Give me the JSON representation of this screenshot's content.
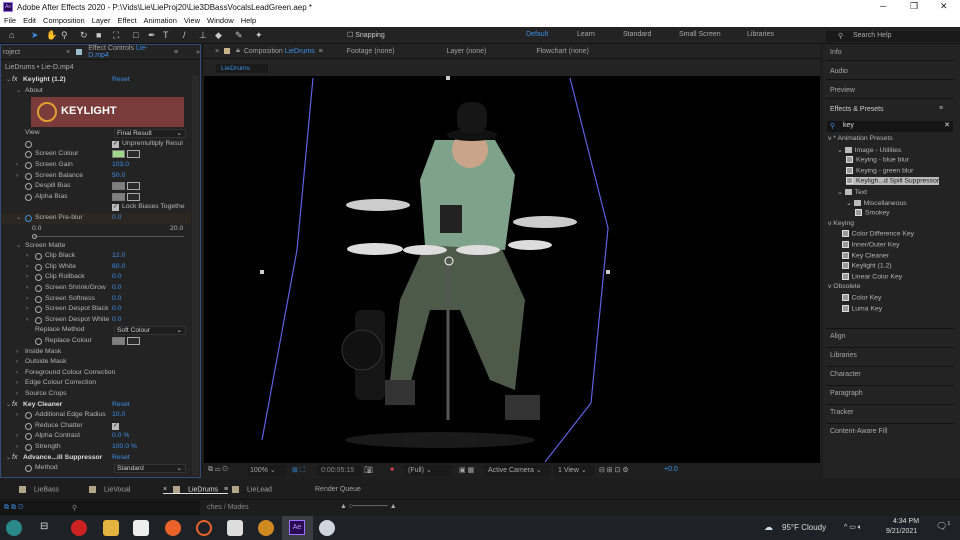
{
  "window": {
    "title": "Adobe After Effects 2020 - P:\\Vids\\Lie\\LieProj20\\Lie3DBassVocalsLeadGreen.aep *",
    "app_icon": "Ae"
  },
  "menu": [
    "File",
    "Edit",
    "Composition",
    "Layer",
    "Effect",
    "Animation",
    "View",
    "Window",
    "Help"
  ],
  "toolbar": {
    "snapping": "Snapping",
    "workspaces": [
      "Default",
      "Learn",
      "Standard",
      "Small Screen",
      "Libraries"
    ],
    "search_help": "Search Help"
  },
  "left_panel": {
    "tab_project": "roject",
    "tab_effect_controls": "Effect Controls",
    "tab_layer": "Lie-D.mp4",
    "subtitle": "LieDrums • Lie-D.mp4",
    "banner_text": "KEYLIGHT",
    "rows": [
      {
        "label": "Keylight (1.2)",
        "fx": true,
        "tw": "v",
        "val": "Reset",
        "type": "reset"
      },
      {
        "label": "About",
        "ind": 1,
        "tw": "v"
      },
      {
        "type": "banner"
      },
      {
        "label": "View",
        "ind": 1,
        "val": "Final Result",
        "type": "dd"
      },
      {
        "sw": true,
        "ind": 1,
        "val": "Unpremultiply Resul",
        "type": "check"
      },
      {
        "label": "Screen Colour",
        "ind": 1,
        "sw": true,
        "type": "swatch",
        "color": "#9fd88a"
      },
      {
        "label": "Screen Gain",
        "ind": 1,
        "sw": true,
        "tw": ">",
        "val": "103.0",
        "type": "num"
      },
      {
        "label": "Screen Balance",
        "ind": 1,
        "sw": true,
        "tw": ">",
        "val": "50.0",
        "type": "num"
      },
      {
        "label": "Despill Bias",
        "ind": 1,
        "sw": true,
        "type": "swatch",
        "color": "#808080"
      },
      {
        "label": "Alpha Bias",
        "ind": 1,
        "sw": true,
        "type": "swatch",
        "color": "#808080"
      },
      {
        "ind": 1,
        "val": "Lock Biases Togethe",
        "type": "check"
      },
      {
        "label": "Screen Pre-blur",
        "ind": 1,
        "sw": true,
        "tw": "v",
        "val": "0.0",
        "type": "num",
        "hl": true,
        "swblue": true
      },
      {
        "type": "slider",
        "min": "0.0",
        "max": "20.0",
        "value": 0
      },
      {
        "label": "Screen Matte",
        "ind": 1,
        "tw": "v"
      },
      {
        "label": "Clip Black",
        "ind": 2,
        "sw": true,
        "tw": ">",
        "val": "12.0",
        "type": "num"
      },
      {
        "label": "Clip White",
        "ind": 2,
        "sw": true,
        "tw": ">",
        "val": "60.0",
        "type": "num"
      },
      {
        "label": "Clip Rollback",
        "ind": 2,
        "sw": true,
        "tw": ">",
        "val": "0.0",
        "type": "num"
      },
      {
        "label": "Screen Shrink/Grow",
        "ind": 2,
        "sw": true,
        "tw": ">",
        "val": "0.0",
        "type": "num"
      },
      {
        "label": "Screen Softness",
        "ind": 2,
        "sw": true,
        "tw": ">",
        "val": "0.0",
        "type": "num"
      },
      {
        "label": "Screen Despot Black",
        "ind": 2,
        "sw": true,
        "tw": ">",
        "val": "0.0",
        "type": "num"
      },
      {
        "label": "Screen Despot White",
        "ind": 2,
        "sw": true,
        "tw": ">",
        "val": "0.0",
        "type": "num"
      },
      {
        "label": "Replace Method",
        "ind": 2,
        "val": "Soft Colour",
        "type": "dd"
      },
      {
        "label": "Replace Colour",
        "ind": 2,
        "sw": true,
        "type": "swatch",
        "color": "#808080"
      },
      {
        "label": "Inside Mask",
        "ind": 1,
        "tw": ">"
      },
      {
        "label": "Outside Mask",
        "ind": 1,
        "tw": ">"
      },
      {
        "label": "Foreground Colour Correction",
        "ind": 1,
        "tw": ">"
      },
      {
        "label": "Edge Colour Correction",
        "ind": 1,
        "tw": ">"
      },
      {
        "label": "Source Crops",
        "ind": 1,
        "tw": ">"
      },
      {
        "label": "Key Cleaner",
        "fx": true,
        "tw": "v",
        "val": "Reset",
        "type": "reset"
      },
      {
        "label": "Additional Edge Radius",
        "ind": 1,
        "sw": true,
        "tw": ">",
        "val": "10.0",
        "type": "num"
      },
      {
        "label": "Reduce Chatter",
        "ind": 1,
        "sw": true,
        "type": "check",
        "val": ""
      },
      {
        "label": "Alpha Contrast",
        "ind": 1,
        "sw": true,
        "tw": ">",
        "val": "0.0 %",
        "type": "num"
      },
      {
        "label": "Strength",
        "ind": 1,
        "sw": true,
        "tw": ">",
        "val": "100.0 %",
        "type": "num"
      },
      {
        "label": "Advance...ill Suppressor",
        "fx": true,
        "tw": "v",
        "val": "Reset",
        "type": "reset"
      },
      {
        "label": "Method",
        "ind": 1,
        "sw": true,
        "val": "Standard",
        "type": "dd"
      }
    ]
  },
  "comp_panel": {
    "tab_label": "Composition",
    "comp_name": "LieDrums",
    "footage": "Footage (none)",
    "layer": "Layer (none)",
    "flowchart": "Flowchart (none)",
    "sub_tab": "LieDrums",
    "viewer_controls": {
      "zoom": "100%",
      "timecode": "0:00:05:15",
      "resolution": "(Full)",
      "camera": "Active Camera",
      "views": "1 View",
      "exposure": "+0.0"
    }
  },
  "right_panel": {
    "panels_top": [
      "Info",
      "Audio",
      "Preview"
    ],
    "effects_title": "Effects & Presets",
    "search_value": "key",
    "tree": [
      {
        "t": "v * Animation Presets",
        "i": 0
      },
      {
        "t": "Image - Utilities",
        "i": 1,
        "folder": true
      },
      {
        "t": "Keying - blue blur",
        "i": 2,
        "preset": true
      },
      {
        "t": "Keying - green blur",
        "i": 2,
        "preset": true
      },
      {
        "t": "Keyligh...d Spill Suppressor",
        "i": 2,
        "preset": true,
        "sel": true
      },
      {
        "t": "Text",
        "i": 1,
        "folder": true
      },
      {
        "t": "Miscellaneous",
        "i": 2,
        "folder": true
      },
      {
        "t": "Smokey",
        "i": 3,
        "preset": true
      },
      {
        "t": "v Keying",
        "i": 0
      },
      {
        "t": "Color Difference Key",
        "i": 1.5,
        "preset": true
      },
      {
        "t": "Inner/Outer Key",
        "i": 1.5,
        "preset": true
      },
      {
        "t": "Key Cleaner",
        "i": 1.5,
        "preset": true
      },
      {
        "t": "Keylight (1.2)",
        "i": 1.5,
        "preset": true
      },
      {
        "t": "Linear Color Key",
        "i": 1.5,
        "preset": true
      },
      {
        "t": "v Obsolete",
        "i": 0
      },
      {
        "t": "Color Key",
        "i": 1.5,
        "preset": true
      },
      {
        "t": "Luma Key",
        "i": 1.5,
        "preset": true
      }
    ],
    "panels_bottom": [
      "Align",
      "Libraries",
      "Character",
      "Paragraph",
      "Tracker",
      "Content-Aware Fill"
    ]
  },
  "timeline": {
    "tabs": [
      "LieBass",
      "LieVocal",
      "LieDrums",
      "LieLead",
      "Render Queue"
    ],
    "active": "LieDrums",
    "switches": "ches / Modes"
  },
  "taskbar": {
    "weather": "95°F  Cloudy",
    "time": "4:34 PM",
    "date": "9/21/2021",
    "notifications": "1"
  }
}
